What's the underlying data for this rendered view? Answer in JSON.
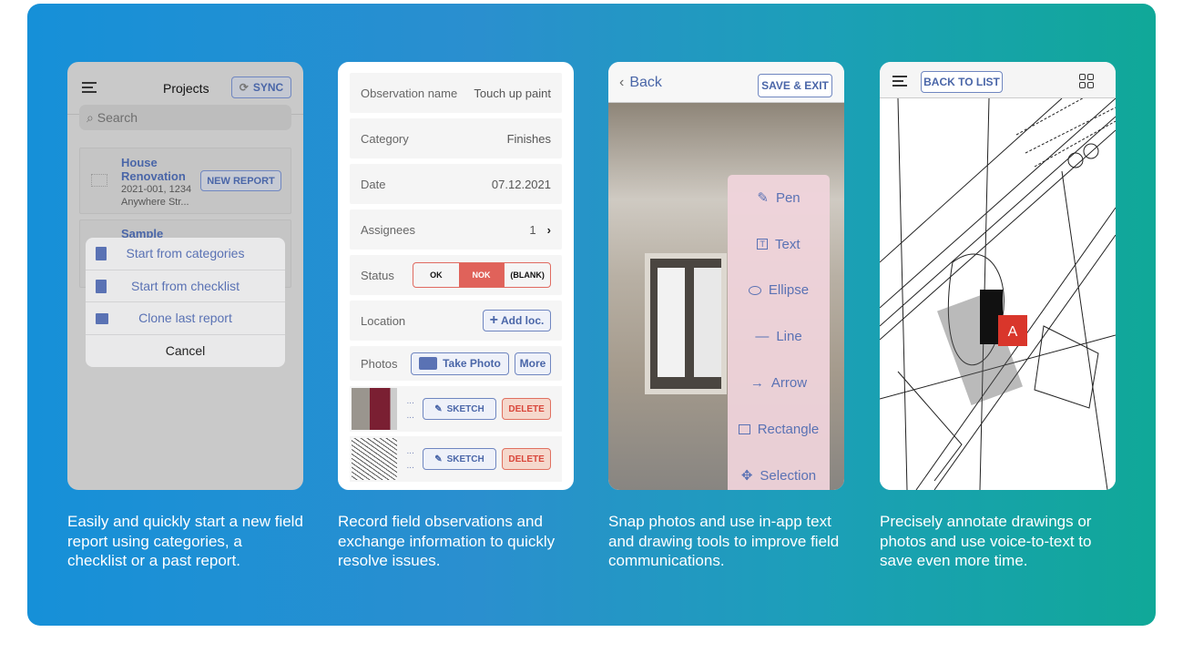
{
  "colors": {
    "accent": "#4a66a8",
    "nok": "#e0625a",
    "banner_left": "#1690d8",
    "banner_right": "#10a898"
  },
  "panel1": {
    "title": "Projects",
    "sync": "SYNC",
    "search_placeholder": "Search",
    "project": {
      "name": "House Renovation",
      "line1": "2021-001, 1234",
      "line2": "Anywhere Str...",
      "new_report": "NEW REPORT"
    },
    "project2": {
      "name": "Sample"
    },
    "sheet": [
      {
        "label": "Start from categories",
        "icon": "document-icon"
      },
      {
        "label": "Start from checklist",
        "icon": "checklist-icon"
      },
      {
        "label": "Clone last report",
        "icon": "clone-icon"
      },
      {
        "label": "Cancel"
      }
    ],
    "caption": "Easily and quickly start a new field report using categories, a checklist or a past report."
  },
  "panel2": {
    "rows": [
      {
        "label": "Observation name",
        "value": "Touch up paint"
      },
      {
        "label": "Category",
        "value": "Finishes"
      },
      {
        "label": "Date",
        "value": "07.12.2021"
      },
      {
        "label": "Assignees",
        "value": "1"
      }
    ],
    "status": {
      "label": "Status",
      "options": [
        "OK",
        "NOK",
        "(BLANK)"
      ],
      "selected": "NOK"
    },
    "location": {
      "label": "Location",
      "button": "Add loc."
    },
    "photos": {
      "label": "Photos",
      "take": "Take Photo",
      "more": "More",
      "sketch": "SKETCH",
      "delete": "DELETE",
      "ellipsis": "..."
    },
    "caption": "Record field observations and exchange information to quickly resolve issues."
  },
  "panel3": {
    "back": "Back",
    "save": "SAVE & EXIT",
    "tools": [
      {
        "label": "Pen",
        "icon": "pen-icon"
      },
      {
        "label": "Text",
        "icon": "text-icon"
      },
      {
        "label": "Ellipse",
        "icon": "ellipse-icon"
      },
      {
        "label": "Line",
        "icon": "line-icon"
      },
      {
        "label": "Arrow",
        "icon": "arrow-icon"
      },
      {
        "label": "Rectangle",
        "icon": "rectangle-icon"
      },
      {
        "label": "Selection",
        "icon": "move-icon"
      }
    ],
    "caption": "Snap photos and use in-app text and drawing tools to improve field communications."
  },
  "panel4": {
    "back": "BACK TO LIST",
    "marker": "A",
    "caption": "Precisely annotate drawings or photos and use voice-to-text to save even more time."
  }
}
